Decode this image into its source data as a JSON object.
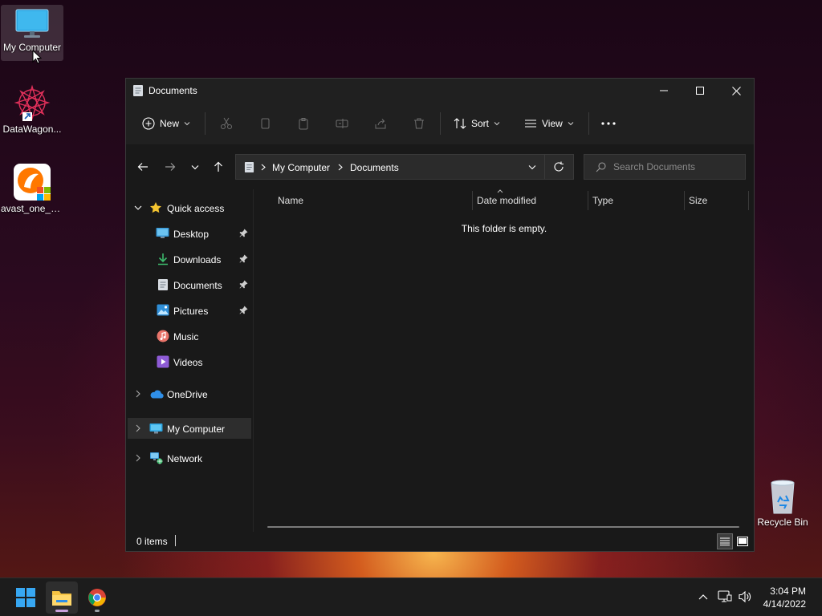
{
  "desktop": {
    "icons": [
      {
        "label": "My Computer"
      },
      {
        "label": "DataWagon..."
      },
      {
        "label": "avast_one_e..."
      },
      {
        "label": "Recycle Bin"
      }
    ]
  },
  "window": {
    "title": "Documents",
    "toolbar": {
      "new_label": "New",
      "sort_label": "Sort",
      "view_label": "View"
    },
    "address": {
      "crumbs": [
        "My Computer",
        "Documents"
      ]
    },
    "search": {
      "placeholder": "Search Documents"
    },
    "nav": {
      "quick_access": "Quick access",
      "quick_items": [
        {
          "label": "Desktop"
        },
        {
          "label": "Downloads"
        },
        {
          "label": "Documents"
        },
        {
          "label": "Pictures"
        },
        {
          "label": "Music"
        },
        {
          "label": "Videos"
        }
      ],
      "onedrive": "OneDrive",
      "my_computer": "My Computer",
      "network": "Network"
    },
    "columns": {
      "name": "Name",
      "date_modified": "Date modified",
      "type": "Type",
      "size": "Size"
    },
    "empty_message": "This folder is empty.",
    "status": {
      "items": "0 items"
    }
  },
  "taskbar": {
    "time": "3:04 PM",
    "date": "4/14/2022"
  },
  "colors": {
    "accent": "#0078d4",
    "folder": "#f6c343",
    "window_bg": "#191919",
    "toolbar_bg": "#202020"
  }
}
